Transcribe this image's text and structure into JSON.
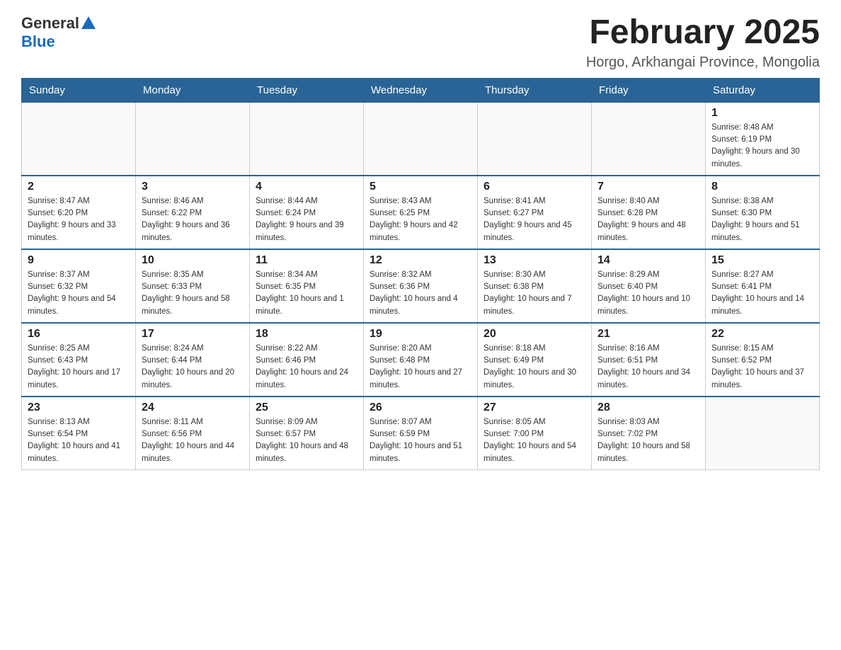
{
  "header": {
    "logo": {
      "general": "General",
      "blue": "Blue"
    },
    "title": "February 2025",
    "location": "Horgo, Arkhangai Province, Mongolia"
  },
  "calendar": {
    "days_of_week": [
      "Sunday",
      "Monday",
      "Tuesday",
      "Wednesday",
      "Thursday",
      "Friday",
      "Saturday"
    ],
    "weeks": [
      [
        {
          "day": "",
          "info": ""
        },
        {
          "day": "",
          "info": ""
        },
        {
          "day": "",
          "info": ""
        },
        {
          "day": "",
          "info": ""
        },
        {
          "day": "",
          "info": ""
        },
        {
          "day": "",
          "info": ""
        },
        {
          "day": "1",
          "info": "Sunrise: 8:48 AM\nSunset: 6:19 PM\nDaylight: 9 hours and 30 minutes."
        }
      ],
      [
        {
          "day": "2",
          "info": "Sunrise: 8:47 AM\nSunset: 6:20 PM\nDaylight: 9 hours and 33 minutes."
        },
        {
          "day": "3",
          "info": "Sunrise: 8:46 AM\nSunset: 6:22 PM\nDaylight: 9 hours and 36 minutes."
        },
        {
          "day": "4",
          "info": "Sunrise: 8:44 AM\nSunset: 6:24 PM\nDaylight: 9 hours and 39 minutes."
        },
        {
          "day": "5",
          "info": "Sunrise: 8:43 AM\nSunset: 6:25 PM\nDaylight: 9 hours and 42 minutes."
        },
        {
          "day": "6",
          "info": "Sunrise: 8:41 AM\nSunset: 6:27 PM\nDaylight: 9 hours and 45 minutes."
        },
        {
          "day": "7",
          "info": "Sunrise: 8:40 AM\nSunset: 6:28 PM\nDaylight: 9 hours and 48 minutes."
        },
        {
          "day": "8",
          "info": "Sunrise: 8:38 AM\nSunset: 6:30 PM\nDaylight: 9 hours and 51 minutes."
        }
      ],
      [
        {
          "day": "9",
          "info": "Sunrise: 8:37 AM\nSunset: 6:32 PM\nDaylight: 9 hours and 54 minutes."
        },
        {
          "day": "10",
          "info": "Sunrise: 8:35 AM\nSunset: 6:33 PM\nDaylight: 9 hours and 58 minutes."
        },
        {
          "day": "11",
          "info": "Sunrise: 8:34 AM\nSunset: 6:35 PM\nDaylight: 10 hours and 1 minute."
        },
        {
          "day": "12",
          "info": "Sunrise: 8:32 AM\nSunset: 6:36 PM\nDaylight: 10 hours and 4 minutes."
        },
        {
          "day": "13",
          "info": "Sunrise: 8:30 AM\nSunset: 6:38 PM\nDaylight: 10 hours and 7 minutes."
        },
        {
          "day": "14",
          "info": "Sunrise: 8:29 AM\nSunset: 6:40 PM\nDaylight: 10 hours and 10 minutes."
        },
        {
          "day": "15",
          "info": "Sunrise: 8:27 AM\nSunset: 6:41 PM\nDaylight: 10 hours and 14 minutes."
        }
      ],
      [
        {
          "day": "16",
          "info": "Sunrise: 8:25 AM\nSunset: 6:43 PM\nDaylight: 10 hours and 17 minutes."
        },
        {
          "day": "17",
          "info": "Sunrise: 8:24 AM\nSunset: 6:44 PM\nDaylight: 10 hours and 20 minutes."
        },
        {
          "day": "18",
          "info": "Sunrise: 8:22 AM\nSunset: 6:46 PM\nDaylight: 10 hours and 24 minutes."
        },
        {
          "day": "19",
          "info": "Sunrise: 8:20 AM\nSunset: 6:48 PM\nDaylight: 10 hours and 27 minutes."
        },
        {
          "day": "20",
          "info": "Sunrise: 8:18 AM\nSunset: 6:49 PM\nDaylight: 10 hours and 30 minutes."
        },
        {
          "day": "21",
          "info": "Sunrise: 8:16 AM\nSunset: 6:51 PM\nDaylight: 10 hours and 34 minutes."
        },
        {
          "day": "22",
          "info": "Sunrise: 8:15 AM\nSunset: 6:52 PM\nDaylight: 10 hours and 37 minutes."
        }
      ],
      [
        {
          "day": "23",
          "info": "Sunrise: 8:13 AM\nSunset: 6:54 PM\nDaylight: 10 hours and 41 minutes."
        },
        {
          "day": "24",
          "info": "Sunrise: 8:11 AM\nSunset: 6:56 PM\nDaylight: 10 hours and 44 minutes."
        },
        {
          "day": "25",
          "info": "Sunrise: 8:09 AM\nSunset: 6:57 PM\nDaylight: 10 hours and 48 minutes."
        },
        {
          "day": "26",
          "info": "Sunrise: 8:07 AM\nSunset: 6:59 PM\nDaylight: 10 hours and 51 minutes."
        },
        {
          "day": "27",
          "info": "Sunrise: 8:05 AM\nSunset: 7:00 PM\nDaylight: 10 hours and 54 minutes."
        },
        {
          "day": "28",
          "info": "Sunrise: 8:03 AM\nSunset: 7:02 PM\nDaylight: 10 hours and 58 minutes."
        },
        {
          "day": "",
          "info": ""
        }
      ]
    ]
  }
}
